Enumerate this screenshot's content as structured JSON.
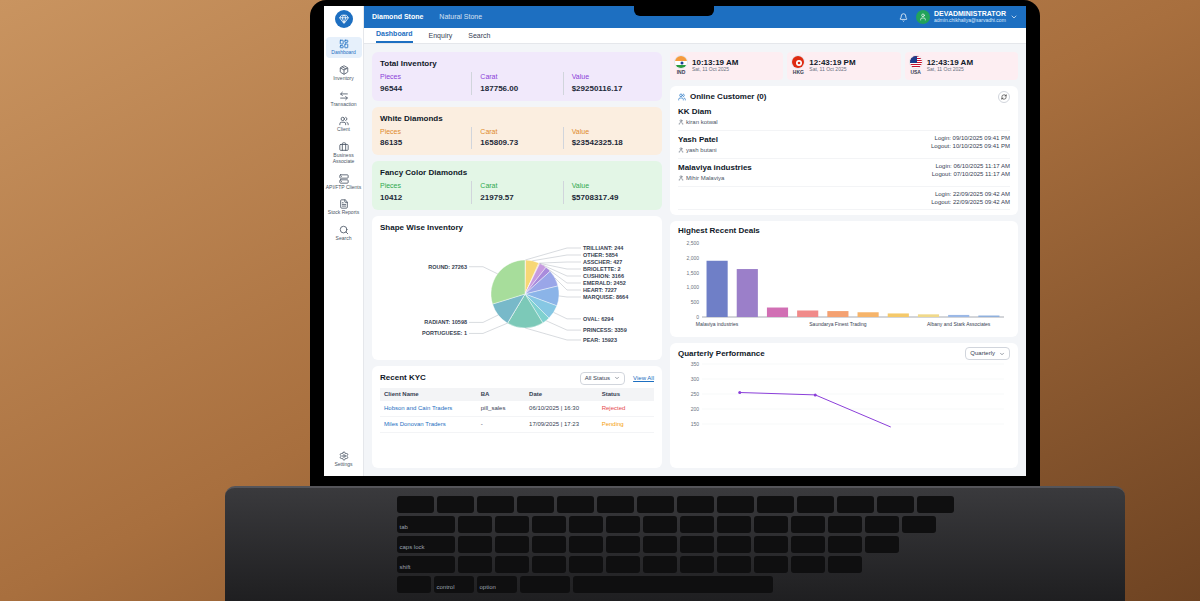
{
  "header": {
    "tabs": [
      {
        "label": "Diamond Stone",
        "selected": true
      },
      {
        "label": "Natural Stone",
        "selected": false
      }
    ],
    "user": {
      "name": "DEVADMINISTRATOR",
      "email": "admin.chikhaliya@sarvadhi.com"
    }
  },
  "sub_tabs": [
    {
      "label": "Dashboard",
      "selected": true
    },
    {
      "label": "Enquiry",
      "selected": false
    },
    {
      "label": "Search",
      "selected": false
    }
  ],
  "sidebar": {
    "items": [
      {
        "label": "Dashboard",
        "selected": true
      },
      {
        "label": "Inventory",
        "selected": false
      },
      {
        "label": "Transaction",
        "selected": false
      },
      {
        "label": "Client",
        "selected": false
      },
      {
        "label": "Business Associate",
        "selected": false
      },
      {
        "label": "API/FTP Clients",
        "selected": false
      },
      {
        "label": "Stock Reports",
        "selected": false
      },
      {
        "label": "Search",
        "selected": false
      }
    ],
    "footer": {
      "label": "Settings"
    }
  },
  "inventory_cards": [
    {
      "title": "Total Inventory",
      "bg": "#f1e9fb",
      "color": "#8b3fd9",
      "metrics": [
        {
          "label": "Pieces",
          "value": "96544"
        },
        {
          "label": "Carat",
          "value": "187756.00"
        },
        {
          "label": "Value",
          "value": "$29250116.17"
        }
      ]
    },
    {
      "title": "White Diamonds",
      "bg": "#fbeee0",
      "color": "#e08a2c",
      "metrics": [
        {
          "label": "Pieces",
          "value": "86135"
        },
        {
          "label": "Carat",
          "value": "165809.73"
        },
        {
          "label": "Value",
          "value": "$23542325.18"
        }
      ]
    },
    {
      "title": "Fancy Color Diamonds",
      "bg": "#e3f6e6",
      "color": "#2fa84f",
      "metrics": [
        {
          "label": "Pieces",
          "value": "10412"
        },
        {
          "label": "Carat",
          "value": "21979.57"
        },
        {
          "label": "Value",
          "value": "$5708317.49"
        }
      ]
    }
  ],
  "shape_inventory": {
    "title": "Shape Wise Inventory",
    "slices": [
      {
        "label": "TRILLIANT: 244",
        "value": 244,
        "color": "#f4a3a8"
      },
      {
        "label": "OTHER: 5854",
        "value": 5854,
        "color": "#f7d774"
      },
      {
        "label": "ASSCHER: 427",
        "value": 427,
        "color": "#f5b97a"
      },
      {
        "label": "BRIOLETTE: 2",
        "value": 2,
        "color": "#e58fb5"
      },
      {
        "label": "CUSHION: 3166",
        "value": 3166,
        "color": "#c79be0"
      },
      {
        "label": "EMERALD: 2452",
        "value": 2452,
        "color": "#a98bdc"
      },
      {
        "label": "HEART: 7227",
        "value": 7227,
        "color": "#9aa6e8"
      },
      {
        "label": "MARQUISE: 8664",
        "value": 8664,
        "color": "#8bb4e8"
      },
      {
        "label": "OVAL: 6294",
        "value": 6294,
        "color": "#86c7e3"
      },
      {
        "label": "PRINCESS: 3359",
        "value": 3359,
        "color": "#7fd1cf"
      },
      {
        "label": "PEAR: 15923",
        "value": 15923,
        "color": "#7cc9b8"
      },
      {
        "label": "PORTUGUESE: 1",
        "value": 1,
        "color": "#9bd6a6"
      },
      {
        "label": "RADIANT: 10598",
        "value": 10598,
        "color": "#78b9c9"
      },
      {
        "label": "ROUND: 27263",
        "value": 27263,
        "color": "#a7dd9b"
      }
    ]
  },
  "kyc": {
    "title": "Recent KYC",
    "filter": "All Status",
    "view_all": "View All",
    "columns": [
      "Client Name",
      "BA",
      "Date",
      "Status"
    ],
    "rows": [
      {
        "client": "Hobson and Cain Traders",
        "ba": "pill_sales",
        "date": "06/10/2025 | 16:30",
        "status": "Rejected",
        "color": "#e5484d"
      },
      {
        "client": "Miles Donovan Traders",
        "ba": "-",
        "date": "17/09/2025 | 17:23",
        "status": "Pending",
        "color": "#f59e0b"
      }
    ]
  },
  "clocks": [
    {
      "code": "IND",
      "kind": "india",
      "time": "10:13:19 AM",
      "date": "Sat, 11 Oct 2025"
    },
    {
      "code": "HKG",
      "kind": "hongkong",
      "time": "12:43:19 PM",
      "date": "Sat, 11 Oct 2025"
    },
    {
      "code": "USA",
      "kind": "usa",
      "time": "12:43:19 AM",
      "date": "Sat, 11 Oct 2025"
    }
  ],
  "online": {
    "title": "Online Customer (0)",
    "customers": [
      {
        "name": "KK Diam",
        "contact": "kiran kotwal"
      },
      {
        "name": "Yash Patel",
        "contact": "yash butani",
        "login": "Login: 09/10/2025 09:41 PM",
        "logout": "Logout: 10/10/2025 09:41 PM"
      },
      {
        "name": "Malaviya industries",
        "contact": "Mihir Malaviya",
        "login": "Login: 06/10/2025 11:17 AM",
        "logout": "Logout: 07/10/2025 11:17 AM"
      },
      {
        "login": "Login: 22/09/2025 09:42 AM",
        "logout": "Logout: 22/09/2025 09:42 AM"
      }
    ]
  },
  "deals": {
    "title": "Highest Recent Deals",
    "y_ticks": [
      "2,500",
      "2,000",
      "1,500",
      "1,000",
      "500",
      "0"
    ],
    "bars": [
      {
        "value": 1900,
        "color": "#6f7fc7"
      },
      {
        "value": 1620,
        "color": "#9b7fc9"
      },
      {
        "value": 320,
        "color": "#d16fb4"
      },
      {
        "value": 220,
        "color": "#f08a8a"
      },
      {
        "value": 200,
        "color": "#f4a172"
      },
      {
        "value": 160,
        "color": "#f6b46a"
      },
      {
        "value": 120,
        "color": "#f5c96a"
      },
      {
        "value": 90,
        "color": "#f0d98a"
      },
      {
        "value": 70,
        "color": "#9bb8e6"
      },
      {
        "value": 50,
        "color": "#8fb0dd"
      }
    ],
    "x_labels": [
      {
        "label": "Malaviya industries",
        "bar": 0
      },
      {
        "label": "Saundarya Finest Trading",
        "bar": 4
      },
      {
        "label": "Albany and Stark Associates",
        "bar": 8
      }
    ]
  },
  "quarterly": {
    "title": "Quarterly Performance",
    "dropdown": "Quarterly",
    "y_ticks": [
      "350",
      "300",
      "250",
      "200",
      "150"
    ],
    "values": [
      255,
      247,
      140
    ]
  },
  "keyboard": {
    "keys": [
      {
        "label": "tab"
      },
      {
        "label": "caps lock"
      },
      {
        "label": "shift"
      },
      {
        "label": "control"
      },
      {
        "label": "option"
      }
    ]
  }
}
